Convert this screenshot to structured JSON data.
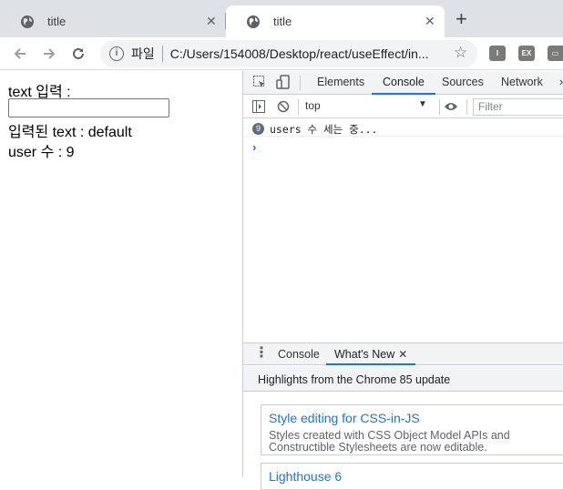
{
  "browser": {
    "tabs": [
      {
        "title": "title",
        "active": false
      },
      {
        "title": "title",
        "active": true
      }
    ],
    "new_tab_glyph": "+",
    "tab_close_glyph": "✕",
    "address": {
      "scheme_label": "파일",
      "url": "C:/Users/154008/Desktop/react/useEffect/in..."
    },
    "extensions": [
      "I",
      "EX",
      "▭"
    ]
  },
  "page": {
    "text_label": "text 입력 :",
    "input_value": "",
    "entered_text_label": "입력된 text : default",
    "user_count_label": "user 수 : 9"
  },
  "devtools": {
    "tabs": [
      "Elements",
      "Console",
      "Sources",
      "Network"
    ],
    "active_tab": "Console",
    "context": "top",
    "filter_placeholder": "Filter",
    "console_messages": [
      {
        "count": "9",
        "text": "users 수 세는 중..."
      }
    ],
    "prompt_glyph": "›",
    "drawer": {
      "tabs": [
        "Console",
        "What's New"
      ],
      "active_tab": "What's New",
      "close_glyph": "✕",
      "highlights_heading": "Highlights from the Chrome 85 update",
      "cards": [
        {
          "title": "Style editing for CSS-in-JS",
          "desc": "Styles created with CSS Object Model APIs and Constructible Stylesheets are now editable."
        },
        {
          "title": "Lighthouse 6",
          "desc": ""
        }
      ]
    }
  },
  "colors": {
    "accent": "#1a73e8",
    "tabstrip": "#dee1e6",
    "devtools_bar": "#f1f3f4"
  }
}
